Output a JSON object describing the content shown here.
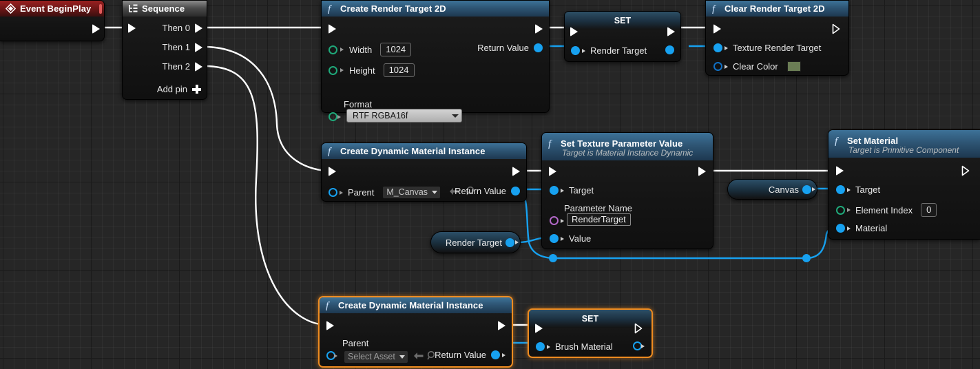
{
  "graph": {
    "background_color": "#262626",
    "selection_color": "#ef8c20",
    "exec_wire_color": "#ffffff",
    "data_wire_color": "#17a1f0"
  },
  "nodes": [
    {
      "id": "event-begin-play",
      "title": "Event BeginPlay",
      "kind": "event",
      "icon": "diamond-event-icon",
      "badge": "stop-icon",
      "pins_out_exec": [
        ""
      ]
    },
    {
      "id": "sequence",
      "title": "Sequence",
      "kind": "sequence",
      "icon": "sequence-icon",
      "outputs": [
        "Then 0",
        "Then 1",
        "Then 2"
      ],
      "add_pin_label": "Add pin"
    },
    {
      "id": "create-render-target-2d",
      "title": "Create Render Target 2D",
      "kind": "function",
      "icon": "function-f-icon",
      "inputs": [
        {
          "label": "Width",
          "value": "1024",
          "pin": "ring-green"
        },
        {
          "label": "Height",
          "value": "1024",
          "pin": "ring-green"
        },
        {
          "label": "Format",
          "value": "RTF RGBA16f",
          "pin": "ring-green",
          "widget": "dropdown"
        }
      ],
      "outputs": [
        {
          "label": "Return Value",
          "pin": "blue"
        }
      ]
    },
    {
      "id": "set-render-target",
      "title": "SET",
      "kind": "set",
      "inputs": [
        {
          "label": "Render Target",
          "pin": "blue"
        }
      ],
      "outputs": [
        {
          "label": "",
          "pin": "blue"
        }
      ]
    },
    {
      "id": "clear-render-target-2d",
      "title": "Clear Render Target 2D",
      "kind": "function",
      "icon": "function-f-icon",
      "inputs": [
        {
          "label": "Texture Render Target",
          "pin": "blue"
        },
        {
          "label": "Clear Color",
          "pin": "ring-blue",
          "widget": "color",
          "color": "#6b7d55"
        }
      ]
    },
    {
      "id": "create-dynamic-material-instance-1",
      "title": "Create Dynamic Material Instance",
      "kind": "function",
      "icon": "function-f-icon",
      "inputs": [
        {
          "label": "Parent",
          "value": "M_Canvas",
          "pin": "ring-cyan",
          "widget": "asset"
        }
      ],
      "outputs": [
        {
          "label": "Return Value",
          "pin": "blue"
        }
      ]
    },
    {
      "id": "set-texture-parameter-value",
      "title": "Set Texture Parameter Value",
      "subtitle": "Target is Material Instance Dynamic",
      "kind": "function",
      "icon": "function-f-icon",
      "inputs": [
        {
          "label": "Target",
          "pin": "blue"
        },
        {
          "label": "Parameter Name",
          "value": "RenderTarget",
          "pin": "ring-purple",
          "widget": "text"
        },
        {
          "label": "Value",
          "pin": "blue"
        }
      ]
    },
    {
      "id": "render-target-getter",
      "title": "Render Target",
      "kind": "variable-get"
    },
    {
      "id": "canvas-getter",
      "title": "Canvas",
      "kind": "variable-get"
    },
    {
      "id": "set-material",
      "title": "Set Material",
      "subtitle": "Target is Primitive Component",
      "kind": "function",
      "icon": "function-f-icon",
      "inputs": [
        {
          "label": "Target",
          "pin": "blue"
        },
        {
          "label": "Element Index",
          "value": "0",
          "pin": "ring-green",
          "widget": "number"
        },
        {
          "label": "Material",
          "pin": "blue"
        }
      ]
    },
    {
      "id": "create-dynamic-material-instance-2",
      "title": "Create Dynamic Material Instance",
      "kind": "function",
      "icon": "function-f-icon",
      "selected": true,
      "inputs": [
        {
          "label": "Parent",
          "value": "Select Asset",
          "pin": "ring-cyan",
          "widget": "asset-empty"
        }
      ],
      "outputs": [
        {
          "label": "Return Value",
          "pin": "blue"
        }
      ]
    },
    {
      "id": "set-brush-material",
      "title": "SET",
      "kind": "set",
      "selected": true,
      "inputs": [
        {
          "label": "Brush Material",
          "pin": "blue"
        }
      ],
      "outputs": [
        {
          "label": "",
          "pin": "ring-cyan"
        }
      ]
    }
  ],
  "labels": {
    "event_begin_play": "Event BeginPlay",
    "sequence": "Sequence",
    "then_0": "Then 0",
    "then_1": "Then 1",
    "then_2": "Then 2",
    "add_pin": "Add pin",
    "create_render_target_2d": "Create Render Target 2D",
    "width": "Width",
    "width_value": "1024",
    "height": "Height",
    "height_value": "1024",
    "format": "Format",
    "format_value": "RTF RGBA16f",
    "return_value": "Return Value",
    "set": "SET",
    "render_target": "Render Target",
    "clear_render_target_2d": "Clear Render Target 2D",
    "texture_render_target": "Texture Render Target",
    "clear_color": "Clear Color",
    "clear_color_value": "#6b7d55",
    "create_dynamic_material_instance": "Create Dynamic Material Instance",
    "parent": "Parent",
    "parent_value_1": "M_Canvas",
    "parent_value_2": "Select Asset",
    "set_texture_parameter_value": "Set Texture Parameter Value",
    "set_texture_parameter_value_sub": "Target is Material Instance Dynamic",
    "target": "Target",
    "parameter_name": "Parameter Name",
    "parameter_name_value": "RenderTarget",
    "value": "Value",
    "canvas": "Canvas",
    "set_material": "Set Material",
    "set_material_sub": "Target is Primitive Component",
    "element_index": "Element Index",
    "element_index_value": "0",
    "material": "Material",
    "brush_material": "Brush Material"
  }
}
